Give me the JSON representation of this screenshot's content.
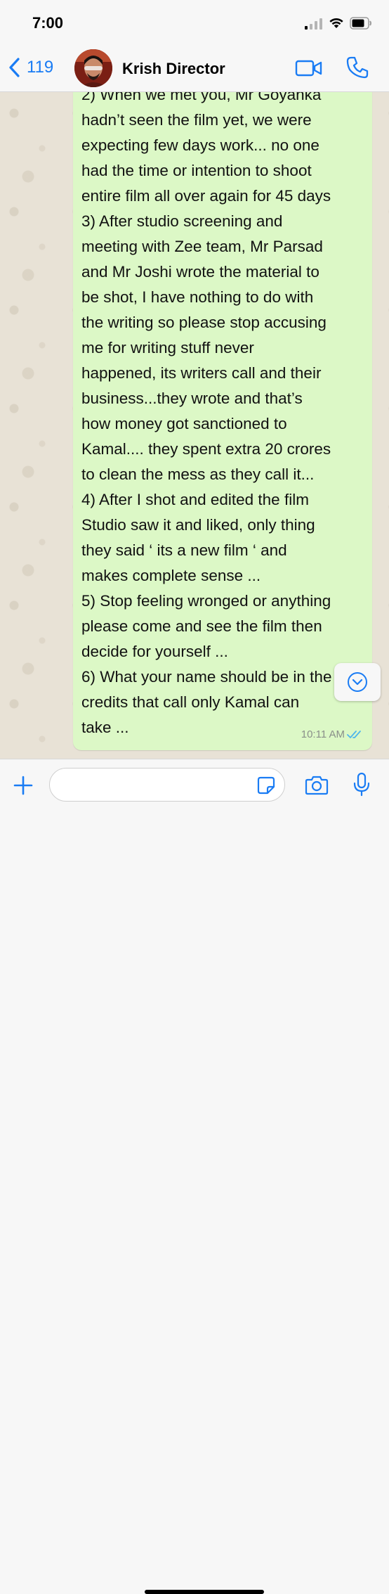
{
  "status_bar": {
    "time": "7:00"
  },
  "header": {
    "back_count": "119",
    "contact_name": "Krish Director"
  },
  "message": {
    "text": "2) When we met you, Mr Goyanka\nhadn’t seen the film yet, we were\nexpecting few days work... no one\nhad the time or intention to shoot\nentire film all over again for 45 days\n3) After studio screening and\nmeeting with Zee team, Mr Parsad\nand Mr Joshi wrote the material to\nbe shot, I have nothing to do with\nthe writing so please stop accusing\nme for writing stuff never\nhappened, its writers call and their\nbusiness...they wrote and that’s\nhow money got sanctioned to\nKamal.... they spent extra 20 crores\nto clean the mess as they call it...\n4) After I shot and edited the film\nStudio saw it and liked, only thing\nthey said ‘ its a new film ‘ and\nmakes complete sense ...\n5) Stop feeling wronged or anything\nplease come and see the film then\ndecide for yourself ...\n6) What your name should be in the\ncredits that call only Kamal can\ntake ...",
    "time": "10:11 AM",
    "status": "read"
  },
  "input": {
    "placeholder": ""
  },
  "colors": {
    "accent": "#1a7cf4",
    "bubble": "#dcf8c6",
    "read_ticks": "#4fb6ec",
    "chat_bg": "#e8e2d6"
  },
  "icons": {
    "back": "chevron-left-icon",
    "video": "video-camera-icon",
    "call": "phone-icon",
    "scroll": "chevron-down-circle-icon",
    "attach": "plus-icon",
    "sticker": "sticker-icon",
    "camera": "camera-icon",
    "mic": "microphone-icon"
  }
}
